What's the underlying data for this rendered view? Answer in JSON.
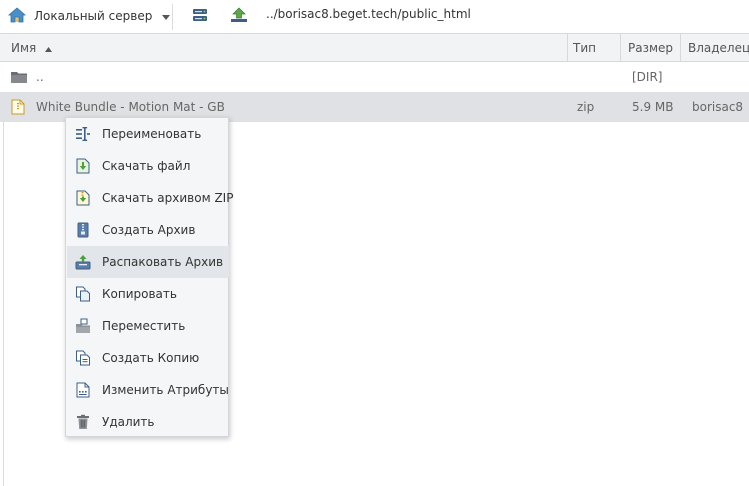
{
  "toolbar": {
    "server_label": "Локальный сервер",
    "path": "../borisac8.beget.tech/public_html"
  },
  "table": {
    "columns": {
      "name": "Имя",
      "type": "Тип",
      "size": "Размер",
      "owner": "Владелец"
    },
    "rows": [
      {
        "name": "..",
        "type": "",
        "size": "[DIR]",
        "owner": ""
      },
      {
        "name": "White Bundle - Motion Mat - GB",
        "type": "zip",
        "size": "5.9 MB",
        "owner": "borisac8"
      }
    ]
  },
  "context_menu": {
    "items": [
      {
        "label": "Переименовать",
        "icon": "rename-icon"
      },
      {
        "label": "Скачать файл",
        "icon": "download-file-icon"
      },
      {
        "label": "Скачать архивом ZIP",
        "icon": "download-zip-icon"
      },
      {
        "label": "Создать Архив",
        "icon": "archive-icon"
      },
      {
        "label": "Распаковать Архив",
        "icon": "extract-archive-icon"
      },
      {
        "label": "Копировать",
        "icon": "copy-icon"
      },
      {
        "label": "Переместить",
        "icon": "move-icon"
      },
      {
        "label": "Создать Копию",
        "icon": "duplicate-icon"
      },
      {
        "label": "Изменить Атрибуты",
        "icon": "attributes-icon"
      },
      {
        "label": "Удалить",
        "icon": "trash-icon"
      }
    ],
    "highlighted_item": "Распаковать Архив"
  }
}
